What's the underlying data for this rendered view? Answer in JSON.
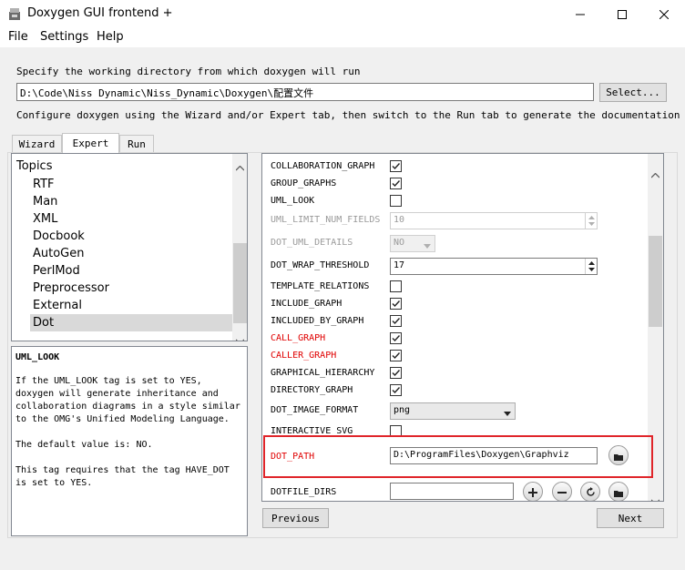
{
  "window": {
    "title": "Doxygen GUI frontend +",
    "controls": {
      "minimize": "minimize-icon",
      "maximize": "maximize-icon",
      "close": "close-icon"
    }
  },
  "menu": [
    "File",
    "Settings",
    "Help"
  ],
  "working_dir": {
    "label": "Specify the working directory from which doxygen will run",
    "value": "D:\\Code\\Niss Dynamic\\Niss_Dynamic\\Doxygen\\配置文件",
    "select_label": "Select..."
  },
  "instructions": "Configure doxygen using the Wizard and/or Expert tab, then switch to the Run tab to generate the documentation",
  "tabs": [
    {
      "label": "Wizard",
      "active": false
    },
    {
      "label": "Expert",
      "active": true
    },
    {
      "label": "Run",
      "active": false
    }
  ],
  "topics": {
    "header": "Topics",
    "items": [
      "RTF",
      "Man",
      "XML",
      "Docbook",
      "AutoGen",
      "PerlMod",
      "Preprocessor",
      "External",
      "Dot"
    ],
    "selected": "Dot"
  },
  "help": {
    "title": "UML_LOOK",
    "paragraphs": [
      "If the UML_LOOK tag is set to YES,\ndoxygen will generate inheritance and\ncollaboration diagrams in a style similar\nto the OMG's Unified Modeling Language.",
      "The default value is: NO.",
      "This tag requires that the tag HAVE_DOT\nis set to YES."
    ]
  },
  "settings": {
    "rows": [
      {
        "label": "COLLABORATION_GRAPH",
        "type": "checkbox",
        "checked": true
      },
      {
        "label": "GROUP_GRAPHS",
        "type": "checkbox",
        "checked": true
      },
      {
        "label": "UML_LOOK",
        "type": "checkbox",
        "checked": false
      },
      {
        "label": "UML_LIMIT_NUM_FIELDS",
        "type": "spinbox",
        "value": "10",
        "disabled": true
      },
      {
        "label": "DOT_UML_DETAILS",
        "type": "combo",
        "value": "NO",
        "disabled": true
      },
      {
        "label": "DOT_WRAP_THRESHOLD",
        "type": "spinbox",
        "value": "17"
      },
      {
        "label": "TEMPLATE_RELATIONS",
        "type": "checkbox",
        "checked": false
      },
      {
        "label": "INCLUDE_GRAPH",
        "type": "checkbox",
        "checked": true
      },
      {
        "label": "INCLUDED_BY_GRAPH",
        "type": "checkbox",
        "checked": true
      },
      {
        "label": "CALL_GRAPH",
        "type": "checkbox",
        "checked": true,
        "modified": true
      },
      {
        "label": "CALLER_GRAPH",
        "type": "checkbox",
        "checked": true,
        "modified": true
      },
      {
        "label": "GRAPHICAL_HIERARCHY",
        "type": "checkbox",
        "checked": true
      },
      {
        "label": "DIRECTORY_GRAPH",
        "type": "checkbox",
        "checked": true
      },
      {
        "label": "DOT_IMAGE_FORMAT",
        "type": "combo",
        "value": "png"
      },
      {
        "label": "INTERACTIVE_SVG",
        "type": "checkbox",
        "checked": false
      },
      {
        "label": "DOT_PATH",
        "type": "path",
        "value": "D:\\ProgramFiles\\Doxygen\\Graphviz",
        "modified": true
      },
      {
        "label": "DOTFILE_DIRS",
        "type": "list",
        "value": ""
      }
    ]
  },
  "nav": {
    "previous": "Previous",
    "next": "Next"
  },
  "colors": {
    "modified": "#e00000",
    "highlight_box": "#e0252a"
  }
}
